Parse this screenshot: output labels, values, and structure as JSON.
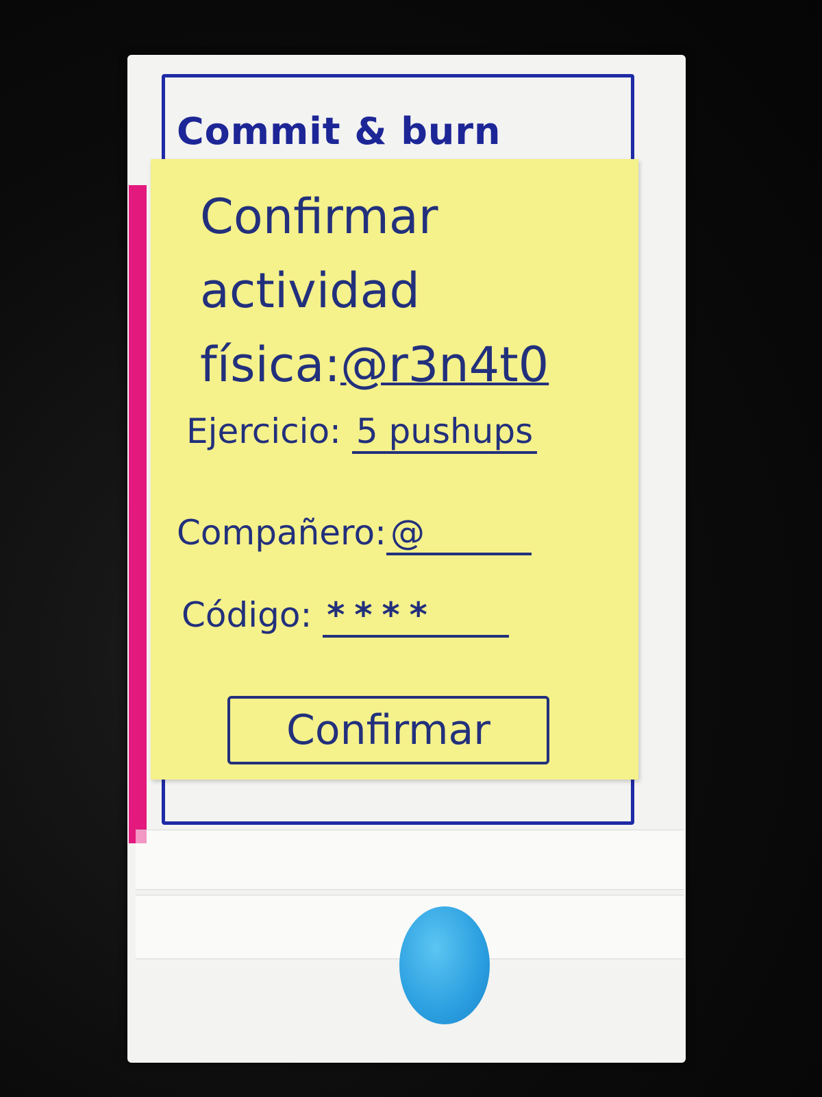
{
  "app": {
    "title": "Commit & burn"
  },
  "screen": {
    "heading_line1": "Confirmar",
    "heading_line2": "actividad",
    "heading_prefix": "física:",
    "heading_user": "@r3n4t0"
  },
  "form": {
    "exercise_label": "Ejercicio:",
    "exercise_value": "5 pushups",
    "partner_label": "Compañero:",
    "partner_value": "@",
    "code_label": "Código:",
    "code_value": "****"
  },
  "actions": {
    "confirm_label": "Confirmar"
  },
  "colors": {
    "ink": "#22307c",
    "frame": "#1f2aa6",
    "sticky": "#f5f18b",
    "home_button": "#2b9fe0",
    "side_strip": "#e4197d"
  }
}
